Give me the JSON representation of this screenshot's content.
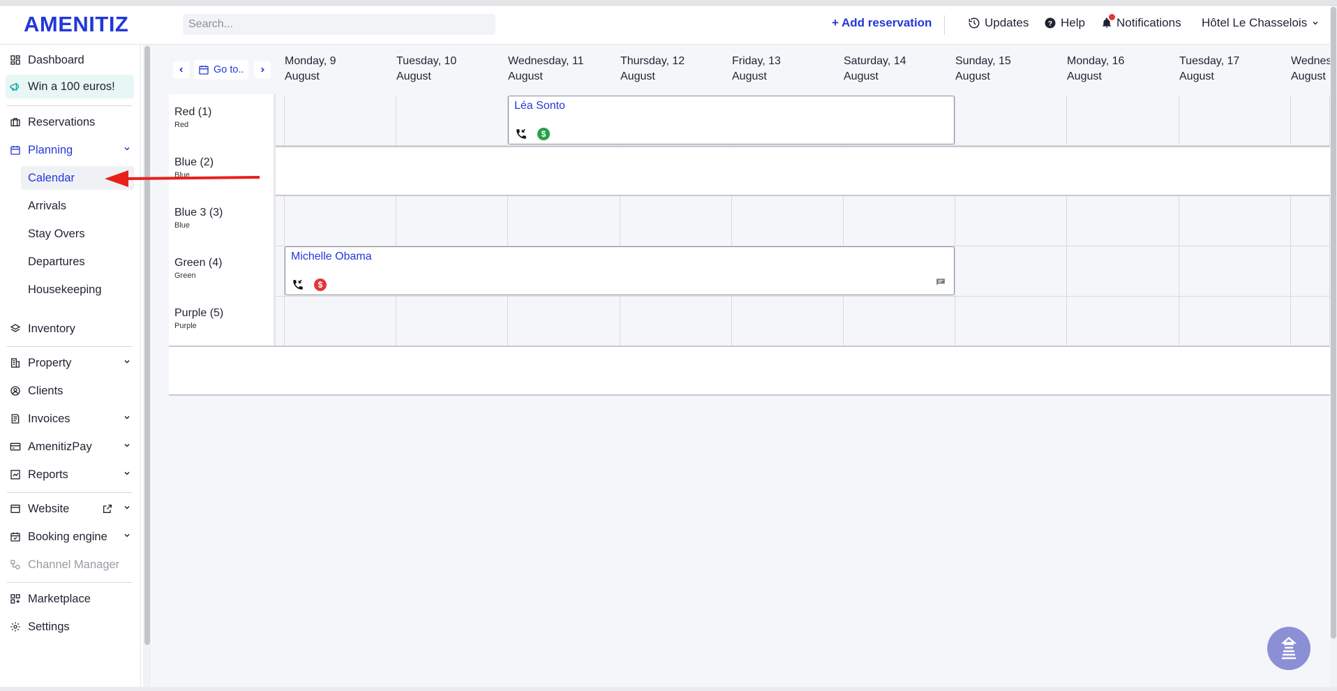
{
  "brand": {
    "logo": "AMENITIZ",
    "accent": "#2338d8"
  },
  "header": {
    "search_placeholder": "Search...",
    "add_reservation": "+ Add reservation",
    "updates": "Updates",
    "help": "Help",
    "notifications": "Notifications",
    "hotel": "Hôtel Le Chasselois"
  },
  "sidebar": {
    "dashboard": "Dashboard",
    "promo": "Win a 100 euros!",
    "reservations": "Reservations",
    "planning": "Planning",
    "calendar": "Calendar",
    "arrivals": "Arrivals",
    "stay_overs": "Stay Overs",
    "departures": "Departures",
    "housekeeping": "Housekeeping",
    "inventory": "Inventory",
    "property": "Property",
    "clients": "Clients",
    "invoices": "Invoices",
    "amenitizpay": "AmenitizPay",
    "reports": "Reports",
    "website": "Website",
    "booking_engine": "Booking engine",
    "channel_manager": "Channel Manager",
    "marketplace": "Marketplace",
    "settings": "Settings"
  },
  "calendar": {
    "goto": "Go to..",
    "days": [
      {
        "day": "Monday, 9",
        "month": "August"
      },
      {
        "day": "Tuesday, 10",
        "month": "August"
      },
      {
        "day": "Wednesday, 11",
        "month": "August"
      },
      {
        "day": "Thursday, 12",
        "month": "August"
      },
      {
        "day": "Friday, 13",
        "month": "August"
      },
      {
        "day": "Saturday, 14",
        "month": "August"
      },
      {
        "day": "Sunday, 15",
        "month": "August"
      },
      {
        "day": "Monday, 16",
        "month": "August"
      },
      {
        "day": "Tuesday, 17",
        "month": "August"
      },
      {
        "day": "Wednes",
        "month": "August"
      }
    ],
    "rooms": [
      {
        "name": "Red (1)",
        "type": "Red"
      },
      {
        "name": "Blue (2)",
        "type": "Blue"
      },
      {
        "name": "Blue 3 (3)",
        "type": "Blue"
      },
      {
        "name": "Green (4)",
        "type": "Green"
      },
      {
        "name": "Purple (5)",
        "type": "Purple"
      }
    ],
    "reservations": [
      {
        "guest": "Léa Sonto",
        "payment_color": "#27a046"
      },
      {
        "guest": "Michelle Obama",
        "payment_color": "#e0383b"
      }
    ]
  }
}
